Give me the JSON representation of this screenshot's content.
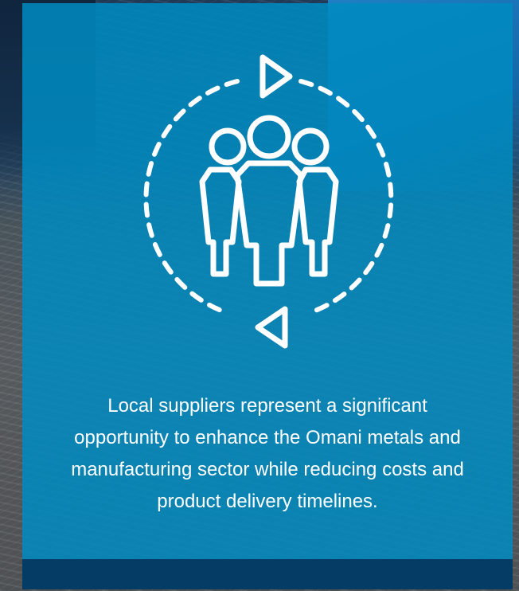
{
  "card": {
    "icon": "people-cycle-icon",
    "caption_lines": [
      "Local suppliers represent a significant",
      "opportunity to enhance the Omani metals and",
      "manufacturing sector while reducing costs and",
      "product delivery timelines."
    ]
  },
  "colors": {
    "card_blue": "#008ac0",
    "footer_navy": "#053c66",
    "text": "#ffffff"
  }
}
